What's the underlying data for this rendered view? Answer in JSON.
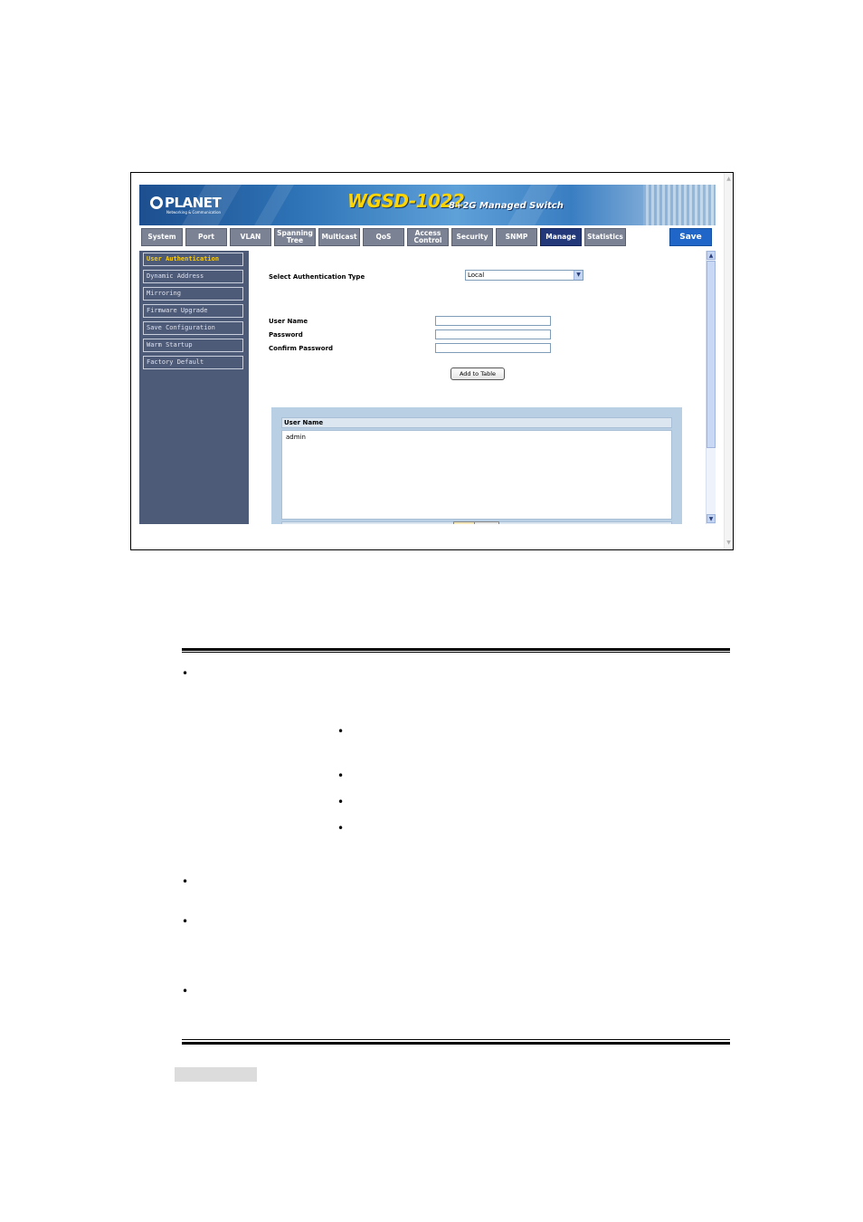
{
  "banner": {
    "brand": "PLANET",
    "brand_sub": "Networking & Communication",
    "model": "WGSD-1022",
    "model_sub": "8+2G Managed Switch"
  },
  "nav": {
    "tabs": [
      {
        "label": "System"
      },
      {
        "label": "Port"
      },
      {
        "label": "VLAN"
      },
      {
        "label": "Spanning Tree"
      },
      {
        "label": "Multicast"
      },
      {
        "label": "QoS"
      },
      {
        "label": "Access Control"
      },
      {
        "label": "Security"
      },
      {
        "label": "SNMP"
      },
      {
        "label": "Manage",
        "active": true
      },
      {
        "label": "Statistics"
      }
    ],
    "save_label": "Save"
  },
  "sidebar": {
    "items": [
      {
        "label": "User Authentication",
        "active": true
      },
      {
        "label": "Dynamic Address"
      },
      {
        "label": "Mirroring"
      },
      {
        "label": "Firmware Upgrade"
      },
      {
        "label": "Save Configuration"
      },
      {
        "label": "Warm Startup"
      },
      {
        "label": "Factory Default"
      }
    ]
  },
  "form": {
    "auth_type_label": "Select Authentication Type",
    "auth_type_value": "Local",
    "username_label": "User Name",
    "password_label": "Password",
    "confirm_password_label": "Confirm Password",
    "add_button_label": "Add to Table"
  },
  "user_table": {
    "header": "User Name",
    "rows": [
      "admin"
    ]
  },
  "document": {
    "bullet_glyph": "•"
  },
  "colors": {
    "nav_tab": "#7b8293",
    "nav_tab_active": "#223878",
    "save_button": "#1f66c8",
    "sidebar_bg": "#4d5a78",
    "sidebar_active_text": "#ffcc00",
    "table_frame": "#b9cfe3",
    "model_text": "#ffd400"
  }
}
